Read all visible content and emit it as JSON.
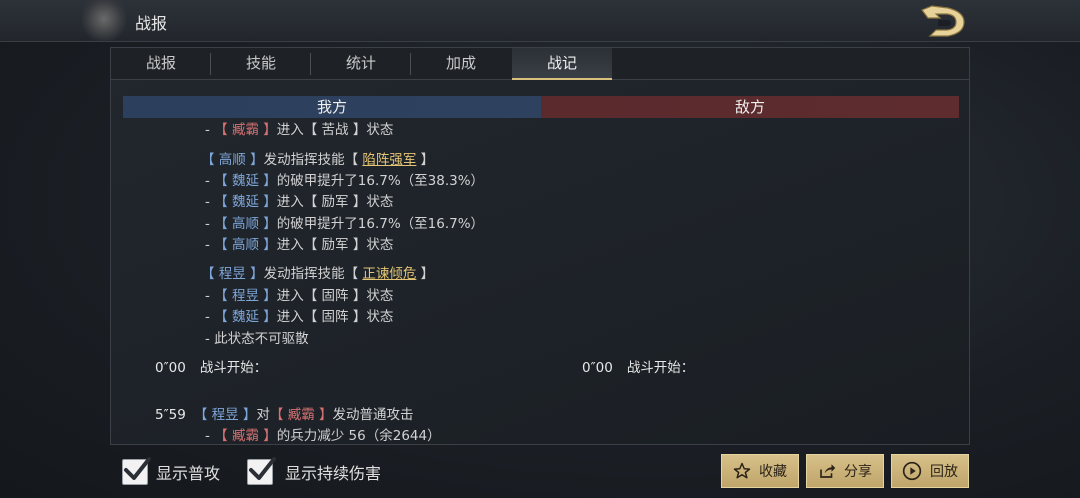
{
  "header": {
    "title": "战报"
  },
  "tabs": [
    {
      "label": "战报",
      "active": false
    },
    {
      "label": "技能",
      "active": false
    },
    {
      "label": "统计",
      "active": false
    },
    {
      "label": "加成",
      "active": false
    },
    {
      "label": "战记",
      "active": true
    }
  ],
  "sides": {
    "ours": "我方",
    "enemy": "敌方"
  },
  "log": {
    "l1": [
      "- ",
      "【 臧霸 】",
      "进入【 苦战 】状态"
    ],
    "l2": [
      "【 高顺 】",
      "发动指挥技能【 ",
      "陷阵强军",
      " 】"
    ],
    "l3": [
      "- ",
      "【 魏延 】",
      "的破甲提升了16.7%（至38.3%）"
    ],
    "l4": [
      "- ",
      "【 魏延 】",
      "进入【 励军 】状态"
    ],
    "l5": [
      "- ",
      "【 高顺 】",
      "的破甲提升了16.7%（至16.7%）"
    ],
    "l6": [
      "- ",
      "【 高顺 】",
      "进入【 励军 】状态"
    ],
    "l7": [
      "【 程昱 】",
      "发动指挥技能【 ",
      "正谏倾危",
      " 】"
    ],
    "l8": [
      "- ",
      "【 程昱 】",
      "进入【 固阵 】状态"
    ],
    "l9": [
      "- ",
      "【 魏延 】",
      "进入【 固阵 】状态"
    ],
    "l10": "- 此状态不可驱散",
    "l11_time": "0″00",
    "l11_text": "战斗开始：",
    "l11e_time": "0″00",
    "l11e_text": "战斗开始：",
    "l12": [
      "5″59",
      "【 程昱 】",
      "对",
      "【 臧霸 】",
      "发动普通攻击"
    ],
    "l13": [
      "- ",
      "【 臧霸 】",
      "的兵力减少 56（余2644）"
    ]
  },
  "options": {
    "show_normal_attack": {
      "label": "显示普攻",
      "checked": true
    },
    "show_dot": {
      "label": "显示持续伤害",
      "checked": true
    }
  },
  "buttons": {
    "favorite": "收藏",
    "share": "分享",
    "replay": "回放"
  },
  "colors": {
    "ally_name": "#7fa6d8",
    "enemy_name": "#d67272",
    "skill": "#e4c574",
    "button": "#d7c08a"
  }
}
